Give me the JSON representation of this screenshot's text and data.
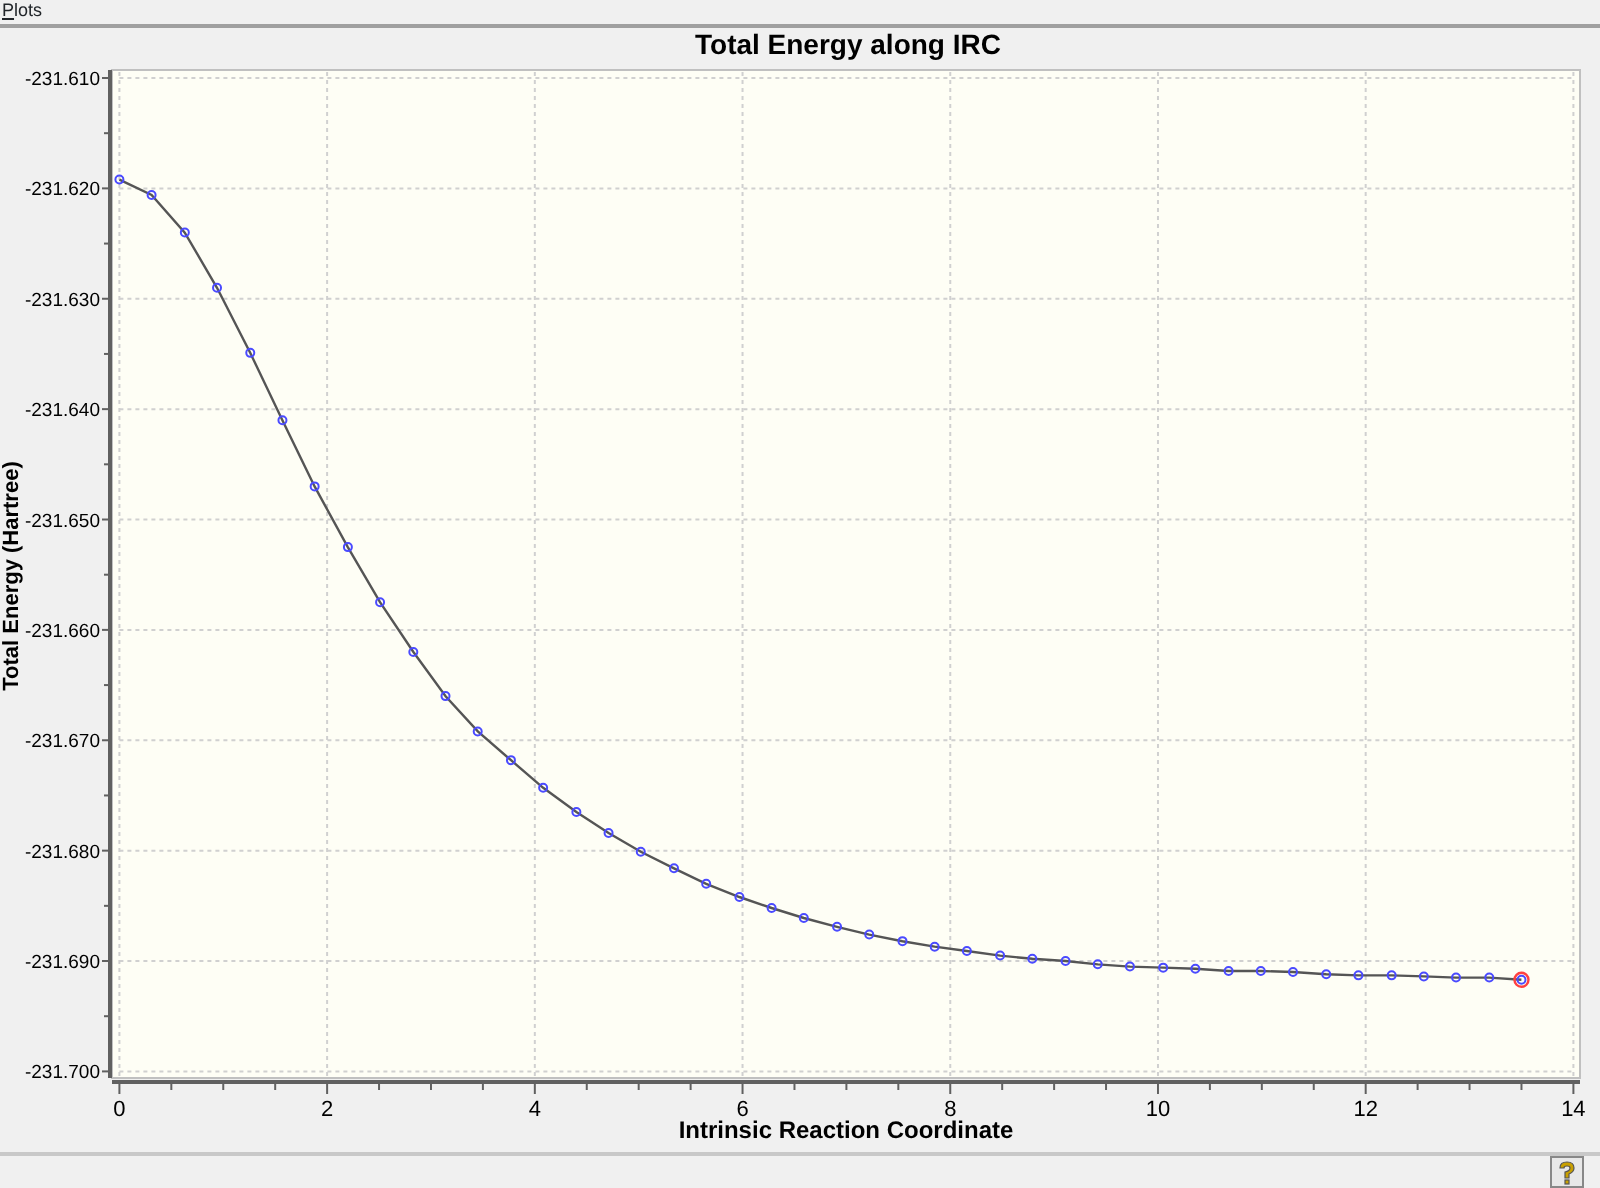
{
  "menu": [
    {
      "label": "Plots"
    }
  ],
  "plot": {
    "chart_data": {
      "type": "line",
      "title": "Total Energy along IRC",
      "xlabel": "Intrinsic Reaction Coordinate",
      "ylabel": "Total Energy (Hartree)",
      "x": [
        0,
        0.31,
        0.63,
        0.94,
        1.26,
        1.57,
        1.88,
        2.2,
        2.51,
        2.83,
        3.14,
        3.45,
        3.77,
        4.08,
        4.4,
        4.71,
        5.02,
        5.34,
        5.65,
        5.97,
        6.28,
        6.59,
        6.91,
        7.22,
        7.54,
        7.85,
        8.16,
        8.48,
        8.79,
        9.11,
        9.42,
        9.73,
        10.05,
        10.36,
        10.68,
        10.99,
        11.3,
        11.62,
        11.93,
        12.25,
        12.56,
        12.87,
        13.19,
        13.5
      ],
      "grid": true,
      "series": [
        {
          "color": "#4a4aff",
          "marker": "circle",
          "values": [
            -231.6192,
            -231.6206,
            -231.624,
            -231.629,
            -231.6349,
            -231.641,
            -231.647,
            -231.6525,
            -231.6575,
            -231.662,
            -231.666,
            -231.6692,
            -231.6718,
            -231.6743,
            -231.6765,
            -231.6784,
            -231.6801,
            -231.6816,
            -231.683,
            -231.6842,
            -231.6852,
            -231.6861,
            -231.6869,
            -231.6876,
            -231.6882,
            -231.6887,
            -231.6891,
            -231.6895,
            -231.6898,
            -231.69,
            -231.6903,
            -231.6905,
            -231.6906,
            -231.6907,
            -231.6909,
            -231.6909,
            -231.691,
            -231.6912,
            -231.6913,
            -231.6913,
            -231.6914,
            -231.6915,
            -231.6915,
            -231.6917
          ]
        },
        {
          "color": "#ff4040",
          "marker": "circle",
          "values": [
            null,
            null,
            null,
            null,
            null,
            null,
            null,
            null,
            null,
            null,
            null,
            null,
            null,
            null,
            null,
            null,
            null,
            null,
            null,
            null,
            null,
            null,
            null,
            null,
            null,
            null,
            null,
            null,
            null,
            null,
            null,
            null,
            null,
            null,
            null,
            null,
            null,
            null,
            null,
            null,
            null,
            null,
            null,
            -231.6917
          ]
        }
      ],
      "xlim": [
        0,
        14
      ],
      "ylim": [
        -231.7,
        -231.61
      ],
      "xticks": [
        0,
        2,
        4,
        6,
        8,
        10,
        12,
        14
      ],
      "yticks": [
        {
          "value": -231.61,
          "label": "-231.610"
        },
        {
          "value": -231.62,
          "label": "-231.620"
        },
        {
          "value": -231.63,
          "label": "-231.630"
        },
        {
          "value": -231.64,
          "label": "-231.640"
        },
        {
          "value": -231.65,
          "label": "-231.650"
        },
        {
          "value": -231.66,
          "label": "-231.660"
        },
        {
          "value": -231.67,
          "label": "-231.670"
        },
        {
          "value": -231.68,
          "label": "-231.680"
        },
        {
          "value": -231.69,
          "label": "-231.690"
        },
        {
          "value": -231.7,
          "label": "-231.700"
        }
      ]
    }
  }
}
